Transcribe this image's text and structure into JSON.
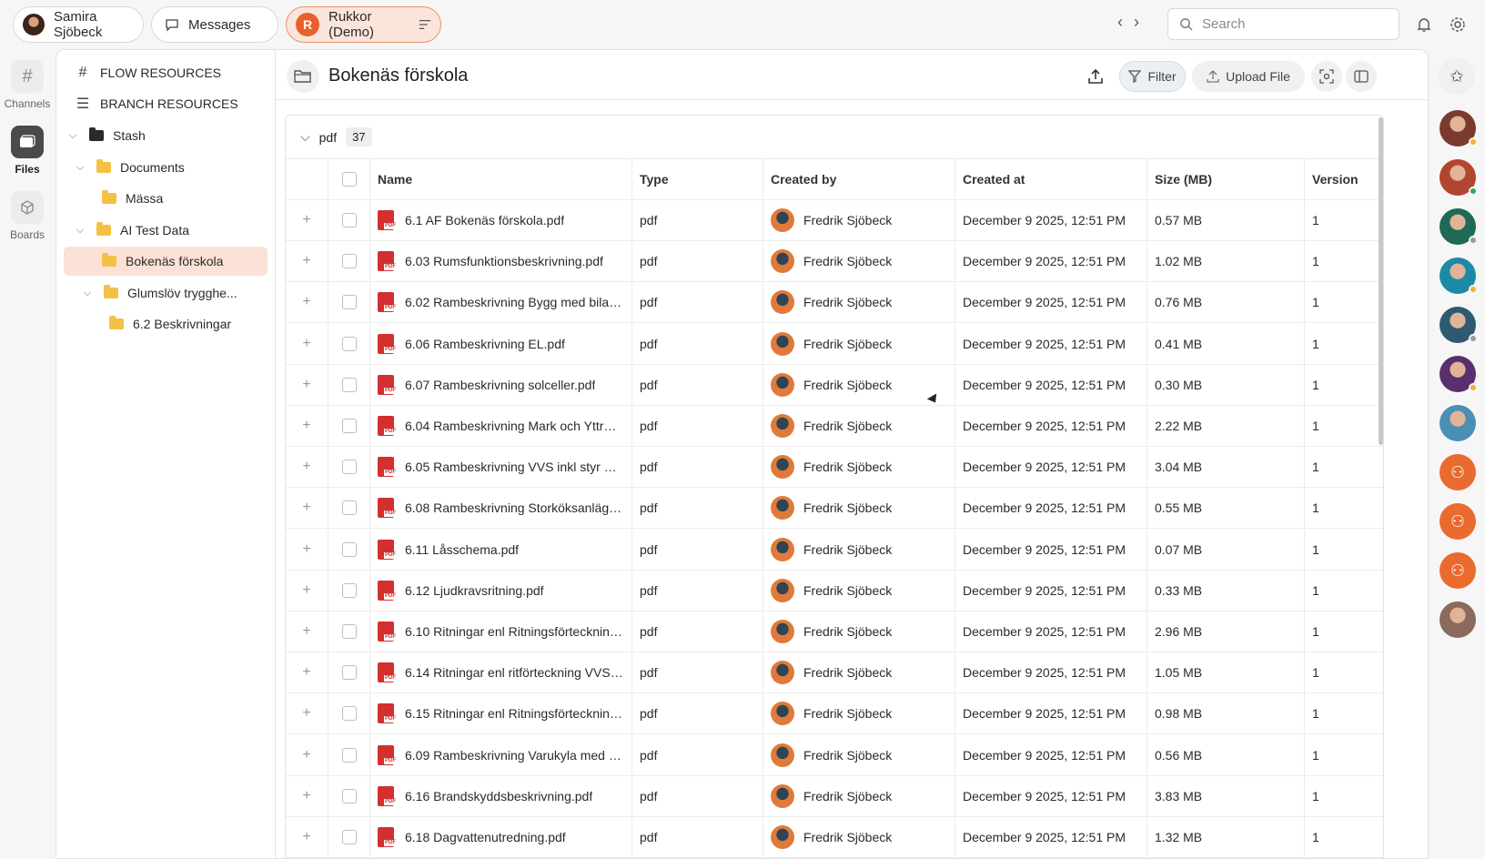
{
  "topbar": {
    "user_name": "Samira Sjöbeck",
    "messages_label": "Messages",
    "workspace_name": "Rukkor (Demo)",
    "workspace_logo_letter": "R",
    "search_placeholder": "Search"
  },
  "rail": {
    "items": [
      {
        "label": "Channels",
        "icon": "hash-icon",
        "active": false
      },
      {
        "label": "Files",
        "icon": "files-icon",
        "active": true
      },
      {
        "label": "Boards",
        "icon": "cube-icon",
        "active": false
      }
    ]
  },
  "tree": {
    "flow_resources": "FLOW RESOURCES",
    "branch_resources": "BRANCH RESOURCES",
    "items": [
      {
        "label": "Stash"
      },
      {
        "label": "Documents"
      },
      {
        "label": "Mässa"
      },
      {
        "label": "AI Test Data"
      },
      {
        "label": "Bokenäs förskola"
      },
      {
        "label": "Glumslöv trygghe..."
      },
      {
        "label": "6.2 Beskrivningar"
      }
    ]
  },
  "header": {
    "title": "Bokenäs förskola",
    "filter_label": "Filter",
    "upload_label": "Upload File"
  },
  "group": {
    "name": "pdf",
    "count": "37"
  },
  "table": {
    "columns": [
      "Name",
      "Type",
      "Created by",
      "Created at",
      "Size (MB)",
      "Version"
    ],
    "rows": [
      {
        "name": "6.1 AF Bokenäs förskola.pdf",
        "type": "pdf",
        "created_by": "Fredrik Sjöbeck",
        "created_at": "December 9 2025, 12:51 PM",
        "size": "0.57 MB",
        "version": "1"
      },
      {
        "name": "6.03 Rumsfunktionsbeskrivning.pdf",
        "type": "pdf",
        "created_by": "Fredrik Sjöbeck",
        "created_at": "December 9 2025, 12:51 PM",
        "size": "1.02 MB",
        "version": "1"
      },
      {
        "name": "6.02 Rambeskrivning Bygg med bilaga....",
        "type": "pdf",
        "created_by": "Fredrik Sjöbeck",
        "created_at": "December 9 2025, 12:51 PM",
        "size": "0.76 MB",
        "version": "1"
      },
      {
        "name": "6.06 Rambeskrivning EL.pdf",
        "type": "pdf",
        "created_by": "Fredrik Sjöbeck",
        "created_at": "December 9 2025, 12:51 PM",
        "size": "0.41 MB",
        "version": "1"
      },
      {
        "name": "6.07 Rambeskrivning solceller.pdf",
        "type": "pdf",
        "created_by": "Fredrik Sjöbeck",
        "created_at": "December 9 2025, 12:51 PM",
        "size": "0.30 MB",
        "version": "1"
      },
      {
        "name": "6.04 Rambeskrivning Mark och Yttre V...",
        "type": "pdf",
        "created_by": "Fredrik Sjöbeck",
        "created_at": "December 9 2025, 12:51 PM",
        "size": "2.22 MB",
        "version": "1"
      },
      {
        "name": "6.05 Rambeskrivning VVS inkl styr och ...",
        "type": "pdf",
        "created_by": "Fredrik Sjöbeck",
        "created_at": "December 9 2025, 12:51 PM",
        "size": "3.04 MB",
        "version": "1"
      },
      {
        "name": "6.08 Rambeskrivning Storköksanläggni...",
        "type": "pdf",
        "created_by": "Fredrik Sjöbeck",
        "created_at": "December 9 2025, 12:51 PM",
        "size": "0.55 MB",
        "version": "1"
      },
      {
        "name": "6.11 Låsschema.pdf",
        "type": "pdf",
        "created_by": "Fredrik Sjöbeck",
        "created_at": "December 9 2025, 12:51 PM",
        "size": "0.07 MB",
        "version": "1"
      },
      {
        "name": "6.12 Ljudkravsritning.pdf",
        "type": "pdf",
        "created_by": "Fredrik Sjöbeck",
        "created_at": "December 9 2025, 12:51 PM",
        "size": "0.33 MB",
        "version": "1"
      },
      {
        "name": "6.10 Ritningar enl Ritningsförteckning ...",
        "type": "pdf",
        "created_by": "Fredrik Sjöbeck",
        "created_at": "December 9 2025, 12:51 PM",
        "size": "2.96 MB",
        "version": "1"
      },
      {
        "name": "6.14 Ritningar enl ritförteckning VVS, s...",
        "type": "pdf",
        "created_by": "Fredrik Sjöbeck",
        "created_at": "December 9 2025, 12:51 PM",
        "size": "1.05 MB",
        "version": "1"
      },
      {
        "name": "6.15 Ritningar enl Ritningsförteckning ...",
        "type": "pdf",
        "created_by": "Fredrik Sjöbeck",
        "created_at": "December 9 2025, 12:51 PM",
        "size": "0.98 MB",
        "version": "1"
      },
      {
        "name": "6.09 Rambeskrivning Varukyla med bil...",
        "type": "pdf",
        "created_by": "Fredrik Sjöbeck",
        "created_at": "December 9 2025, 12:51 PM",
        "size": "0.56 MB",
        "version": "1"
      },
      {
        "name": "6.16 Brandskyddsbeskrivning.pdf",
        "type": "pdf",
        "created_by": "Fredrik Sjöbeck",
        "created_at": "December 9 2025, 12:51 PM",
        "size": "3.83 MB",
        "version": "1"
      },
      {
        "name": "6.18 Dagvattenutredning.pdf",
        "type": "pdf",
        "created_by": "Fredrik Sjöbeck",
        "created_at": "December 9 2025, 12:51 PM",
        "size": "1.32 MB",
        "version": "1"
      }
    ]
  },
  "right_rail": {
    "members": [
      {
        "color": "#7a3b2e",
        "status": "#f2b233"
      },
      {
        "color": "#b2452f",
        "status": "#2eaa5c"
      },
      {
        "color": "#1e6a55",
        "status": "#9a9a9a"
      },
      {
        "color": "#1b8aa6",
        "status": "#f2b233"
      },
      {
        "color": "#2e5a70",
        "status": "#9a9a9a"
      },
      {
        "color": "#5a2f6e",
        "status": "#f2b233"
      },
      {
        "color": "#4a8fb5",
        "status": ""
      },
      {
        "color": "#ea6b2f",
        "status": "",
        "team": true
      },
      {
        "color": "#ea6b2f",
        "status": "",
        "team": true
      },
      {
        "color": "#ea6b2f",
        "status": "",
        "team": true
      },
      {
        "color": "#8a6a5a",
        "status": ""
      }
    ]
  }
}
